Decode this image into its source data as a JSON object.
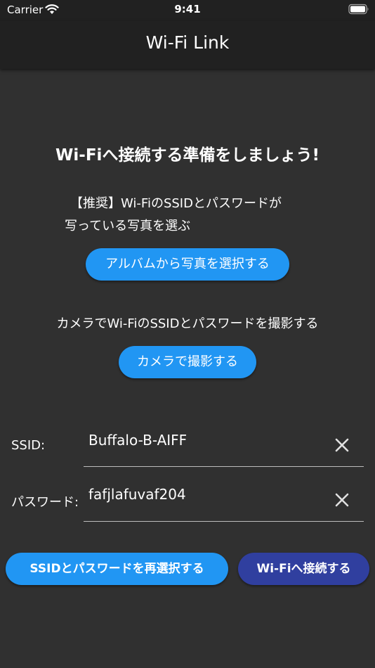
{
  "status_bar": {
    "carrier": "Carrier",
    "time": "9:41"
  },
  "app_bar": {
    "title": "Wi-Fi Link"
  },
  "content": {
    "heading": "Wi-Fiへ接続する準備をしましょう!",
    "recommend_line1": "【推奨】Wi-FiのSSIDとパスワードが",
    "recommend_line2": "写っている写真を選ぶ",
    "album_button": "アルバムから写真を選択する",
    "camera_text": "カメラでWi-FiのSSIDとパスワードを撮影する",
    "camera_button": "カメラで撮影する"
  },
  "form": {
    "ssid_label": "SSID:",
    "ssid_value": "Buffalo-B-AIFF",
    "password_label": "パスワード:",
    "password_value": "fafjlafuvaf204"
  },
  "actions": {
    "reselect_button": "SSIDとパスワードを再選択する",
    "connect_button": "Wi-Fiへ接続する"
  },
  "colors": {
    "background": "#303030",
    "app_bar": "#212121",
    "primary_button": "#2196f3",
    "connect_button": "#303f9f"
  },
  "icons": [
    "wifi-icon",
    "battery-icon",
    "clear-icon"
  ]
}
